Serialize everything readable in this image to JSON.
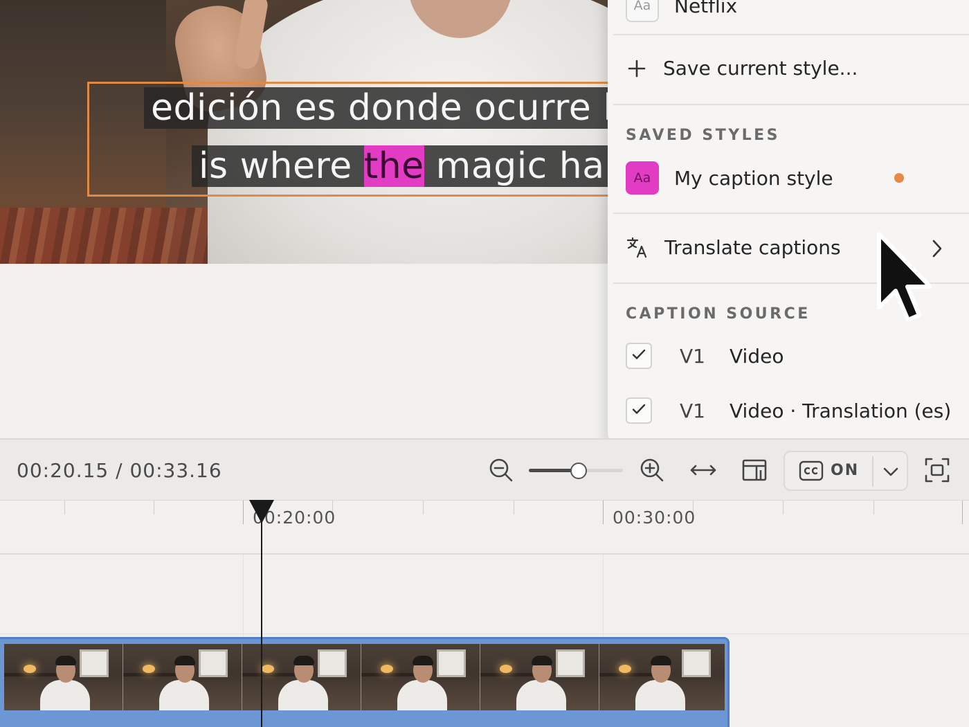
{
  "preview": {
    "caption_line_1": "edición es donde ocurre l",
    "caption_line_2_before": "is where ",
    "caption_line_2_highlight": "the",
    "caption_line_2_after": " magic hap"
  },
  "menu": {
    "netflix_label": "Netflix",
    "swatch_text": "Aa",
    "save_style_label": "Save current style...",
    "saved_styles_title": "SAVED STYLES",
    "saved_style_name": "My caption style",
    "translate_label": "Translate captions",
    "caption_source_title": "CAPTION SOURCE",
    "sources": [
      {
        "track": "V1",
        "name": "Video",
        "checked": true
      },
      {
        "track": "V1",
        "name": "Video · Translation (es)",
        "checked": true
      }
    ]
  },
  "toolbar": {
    "timecode": "00:20.15 / 00:33.16",
    "zoom_level": 0.53,
    "cc_label": "ON"
  },
  "timeline": {
    "tick_labels": [
      "00:20:00",
      "00:30:00"
    ],
    "playhead_time": "00:20.15"
  },
  "colors": {
    "accent_orange": "#e08a45",
    "highlight_pink": "#e23cc4",
    "clip_blue": "#6d97d4"
  },
  "icons": [
    "plus-icon",
    "translate-icon",
    "chevron-right-icon",
    "check-icon",
    "zoom-out-icon",
    "zoom-in-icon",
    "fit-width-icon",
    "layout-icon",
    "closed-captions-icon",
    "chevron-down-icon",
    "fullscreen-icon",
    "mouse-cursor-icon"
  ]
}
